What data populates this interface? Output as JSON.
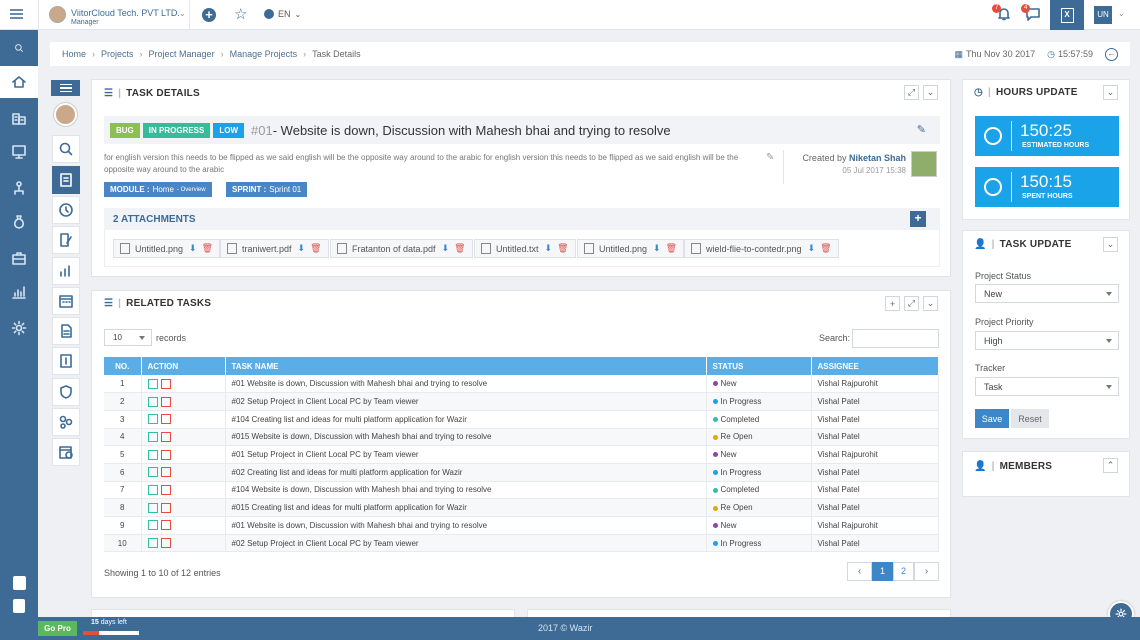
{
  "topbar": {
    "company": "ViitorCloud Tech. PVT LTD.",
    "role": "Manager",
    "language": "EN",
    "notif_count_1": "7",
    "notif_count_2": "4",
    "user_initials": "UN"
  },
  "breadcrumb": {
    "items": [
      "Home",
      "Projects",
      "Project Manager",
      "Manage Projects",
      "Task Details"
    ],
    "date": "Thu Nov 30 2017",
    "time": "15:57:59"
  },
  "task_details": {
    "panel_title": "TASK DETAILS",
    "tags": [
      {
        "label": "BUG",
        "color": "#8cc152"
      },
      {
        "label": "IN PROGRESS",
        "color": "#37bc9b"
      },
      {
        "label": "LOW",
        "color": "#1aa3e8"
      }
    ],
    "task_number": "#01",
    "task_title": " - Website is down, Discussion with Mahesh bhai and trying to resolve",
    "description": "for english version this needs to be flipped as we said english will be the opposite way around to the arabic for english version this needs to be flipped as we said english will be the opposite way around to the arabic",
    "created_by_label": "Created by",
    "created_by_name": "Niketan Shah",
    "created_date": "05 Jul 2017 15:38",
    "module_label": "MODULE :",
    "module_value": "Home",
    "module_sub": "- Overview",
    "sprint_label": "SPRINT :",
    "sprint_value": "Sprint 01",
    "attachments_title": "2 ATTACHMENTS",
    "attachments": [
      "Untitled.png",
      "traniwert.pdf",
      "Fratanton of data.pdf",
      "Untitled.txt",
      "Untitled.png",
      "wield-flie-to-contedr.png"
    ]
  },
  "related_tasks": {
    "panel_title": "RELATED TASKS",
    "page_size": "10",
    "records_label": "records",
    "search_label": "Search:",
    "columns": [
      "NO.",
      "ACTION",
      "TASK NAME",
      "STATUS",
      "ASSIGNEE"
    ],
    "rows": [
      {
        "no": "1",
        "name": "#01 Website is down, Discussion with Mahesh bhai and trying to resolve",
        "status": "New",
        "status_color": "#8e44ad",
        "assignee": "Vishal Rajpurohit"
      },
      {
        "no": "2",
        "name": "#02 Setup Project in Client Local PC by Team viewer",
        "status": "In Progress",
        "status_color": "#1aa3e8",
        "assignee": "Vishal Patel"
      },
      {
        "no": "3",
        "name": "#104 Creating list and ideas for multi platform application for Wazir",
        "status": "Completed",
        "status_color": "#2ebfa5",
        "assignee": "Vishal Patel"
      },
      {
        "no": "4",
        "name": "#015 Website is down, Discussion with Mahesh bhai and trying to resolve",
        "status": "Re Open",
        "status_color": "#e0a800",
        "assignee": "Vishal Patel"
      },
      {
        "no": "5",
        "name": "#01 Setup Project in Client Local PC by Team viewer",
        "status": "New",
        "status_color": "#8e44ad",
        "assignee": "Vishal Rajpurohit"
      },
      {
        "no": "6",
        "name": "#02 Creating list and ideas for multi platform application for Wazir",
        "status": "In Progress",
        "status_color": "#1aa3e8",
        "assignee": "Vishal Patel"
      },
      {
        "no": "7",
        "name": "#104 Website is down, Discussion with Mahesh bhai and trying to resolve",
        "status": "Completed",
        "status_color": "#2ebfa5",
        "assignee": "Vishal Patel"
      },
      {
        "no": "8",
        "name": "#015 Creating list and ideas for multi platform application for Wazir",
        "status": "Re Open",
        "status_color": "#e0a800",
        "assignee": "Vishal Patel"
      },
      {
        "no": "9",
        "name": "#01 Website is down, Discussion with Mahesh bhai and trying to resolve",
        "status": "New",
        "status_color": "#8e44ad",
        "assignee": "Vishal Rajpurohit"
      },
      {
        "no": "10",
        "name": "#02 Setup Project in Client Local PC by Team viewer",
        "status": "In Progress",
        "status_color": "#1aa3e8",
        "assignee": "Vishal Patel"
      }
    ],
    "showing_text": "Showing 1 to 10 of 12 entries",
    "pagination": [
      "‹",
      "1",
      "2",
      "›"
    ]
  },
  "hours_update": {
    "panel_title": "HOURS UPDATE",
    "estimated_value": "150:25",
    "estimated_label": "ESTIMATED HOURS",
    "spent_value": "150:15",
    "spent_label": "SPENT HOURS"
  },
  "task_update": {
    "panel_title": "TASK UPDATE",
    "project_status_label": "Project Status",
    "project_status_value": "New",
    "project_priority_label": "Project Priority",
    "project_priority_value": "High",
    "tracker_label": "Tracker",
    "tracker_value": "Task",
    "save_label": "Save",
    "reset_label": "Reset"
  },
  "members": {
    "panel_title": "MEMBERS"
  },
  "footer": {
    "go_pro": "Go Pro",
    "days_left_num": "15",
    "days_left_text": " days left",
    "days_left_fraction": 0.28,
    "copyright": "2017 © Wazir"
  }
}
